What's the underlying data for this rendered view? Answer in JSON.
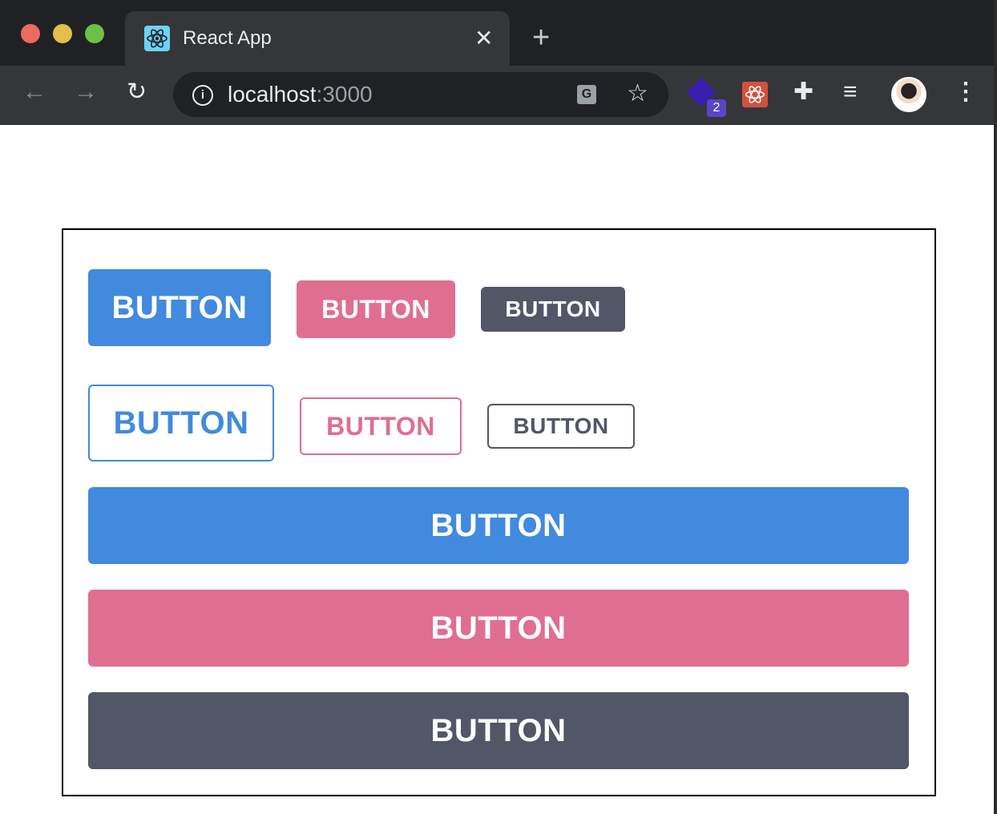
{
  "browser": {
    "tab_title": "React App",
    "url_host": "localhost",
    "url_port": ":3000",
    "extension_badge": "2",
    "icons": [
      "react-favicon",
      "close-tab-icon",
      "new-tab-icon",
      "back-icon",
      "forward-icon",
      "reload-icon",
      "info-icon",
      "translate-icon",
      "star-icon",
      "extension-icon",
      "react-devtools-icon",
      "puzzle-icon",
      "media-icon",
      "avatar",
      "menu-icon"
    ]
  },
  "colors": {
    "primary": "#418ade",
    "pink": "#e06e91",
    "gray": "#535667"
  },
  "buttons": {
    "large_primary": "BUTTON",
    "medium_pink": "BUTTON",
    "small_gray": "BUTTON",
    "outline_large_primary": "BUTTON",
    "outline_medium_pink": "BUTTON",
    "outline_small_gray": "BUTTON",
    "full_primary": "BUTTON",
    "full_pink": "BUTTON",
    "full_gray": "BUTTON"
  }
}
